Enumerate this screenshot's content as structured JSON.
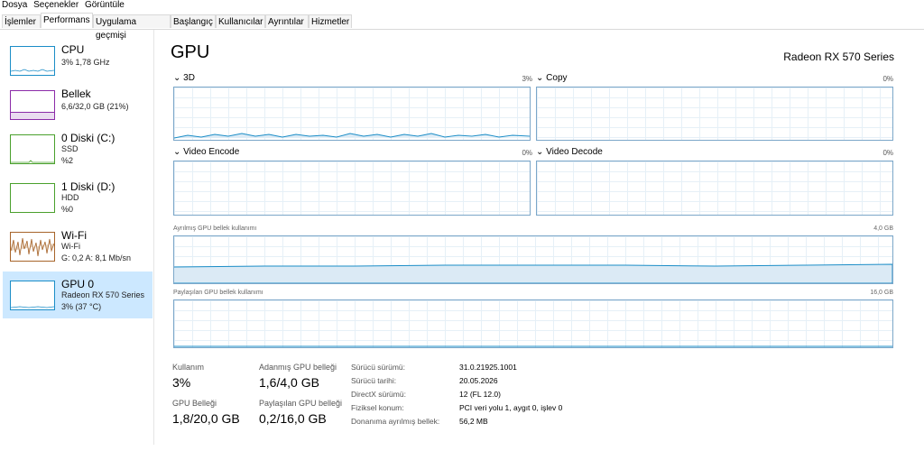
{
  "menu": {
    "items": [
      "Dosya",
      "Seçenekler",
      "Görüntüle"
    ]
  },
  "tabs": [
    {
      "label": "İşlemler"
    },
    {
      "label": "Performans"
    },
    {
      "label": "Uygulama geçmişi"
    },
    {
      "label": "Başlangıç"
    },
    {
      "label": "Kullanıcılar"
    },
    {
      "label": "Ayrıntılar"
    },
    {
      "label": "Hizmetler"
    }
  ],
  "sidebar": {
    "items": [
      {
        "name": "CPU",
        "sub1": "3% 1,78 GHz",
        "sub2": ""
      },
      {
        "name": "Bellek",
        "sub1": "6,6/32,0 GB (21%)",
        "sub2": ""
      },
      {
        "name": "0 Diski (C:)",
        "sub1": "SSD",
        "sub2": "%2"
      },
      {
        "name": "1 Diski (D:)",
        "sub1": "HDD",
        "sub2": "%0"
      },
      {
        "name": "Wi-Fi",
        "sub1": "Wi-Fi",
        "sub2": "G: 0,2 A: 8,1 Mb/sn"
      },
      {
        "name": "GPU 0",
        "sub1": "Radeon RX 570 Series",
        "sub2": "3% (37 °C)"
      }
    ]
  },
  "main": {
    "title": "GPU",
    "device": "Radeon RX 570 Series",
    "engines": [
      {
        "label": "3D",
        "pct": "3%"
      },
      {
        "label": "Copy",
        "pct": "0%"
      },
      {
        "label": "Video Encode",
        "pct": "0%"
      },
      {
        "label": "Video Decode",
        "pct": "0%"
      }
    ],
    "dedicated": {
      "label": "Ayrılmış GPU bellek kullanımı",
      "max": "4,0 GB"
    },
    "shared": {
      "label": "Paylaşılan GPU bellek kullanımı",
      "max": "16,0 GB"
    },
    "stats": {
      "usage_label": "Kullanım",
      "usage": "3%",
      "dedicated_label": "Adanmış GPU belleği",
      "dedicated": "1,6/4,0 GB",
      "gpu_mem_label": "GPU Belleği",
      "gpu_mem": "1,8/20,0 GB",
      "shared_label": "Paylaşılan GPU belleği",
      "shared": "0,2/16,0 GB"
    },
    "info": [
      {
        "label": "Sürücü sürümü:",
        "value": "31.0.21925.1001"
      },
      {
        "label": "Sürücü tarihi:",
        "value": "20.05.2026"
      },
      {
        "label": "DirectX sürümü:",
        "value": "12 (FL 12.0)"
      },
      {
        "label": "Fiziksel konum:",
        "value": "PCI veri yolu 1, aygıt 0, işlev 0"
      },
      {
        "label": "Donanıma ayrılmış bellek:",
        "value": "56,2 MB"
      }
    ]
  },
  "colors": {
    "cpu": "#1b8dc7",
    "memory": "#8b2ba8",
    "disk": "#4aa02c",
    "wifi": "#a7642a",
    "gpu": "#1b8dc7",
    "selected": "#cce8ff"
  }
}
